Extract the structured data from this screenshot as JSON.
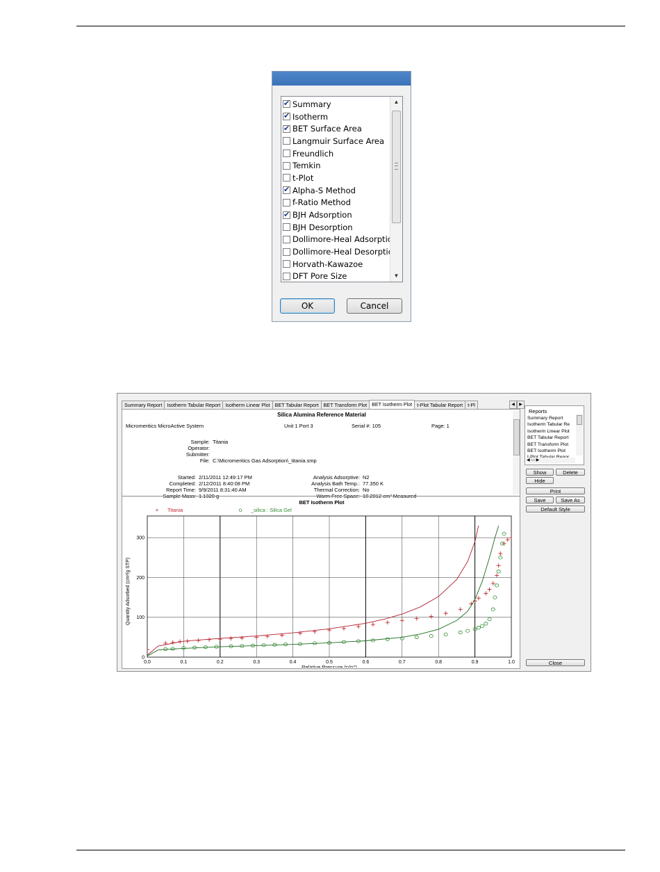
{
  "dialog": {
    "items": [
      {
        "label": "Summary",
        "checked": true
      },
      {
        "label": "Isotherm",
        "checked": true
      },
      {
        "label": "BET Surface Area",
        "checked": true
      },
      {
        "label": "Langmuir Surface Area",
        "checked": false
      },
      {
        "label": "Freundlich",
        "checked": false
      },
      {
        "label": "Temkin",
        "checked": false
      },
      {
        "label": "t-Plot",
        "checked": false
      },
      {
        "label": "Alpha-S Method",
        "checked": true
      },
      {
        "label": "f-Ratio Method",
        "checked": false
      },
      {
        "label": "BJH Adsorption",
        "checked": true
      },
      {
        "label": "BJH Desorption",
        "checked": false
      },
      {
        "label": "Dollimore-Heal Adsorption",
        "checked": false
      },
      {
        "label": "Dollimore-Heal Desorption",
        "checked": false
      },
      {
        "label": "Horvath-Kawazoe",
        "checked": false
      },
      {
        "label": "DFT Pore Size",
        "checked": false
      }
    ],
    "ok_label": "OK",
    "cancel_label": "Cancel"
  },
  "report_window": {
    "tabs": [
      "Summary Report",
      "Isotherm Tabular Report",
      "Isotherm Linear Plot",
      "BET Tabular Report",
      "BET Transform Plot",
      "BET Isotherm Plot",
      "t-Plot Tabular Report",
      "t-Pl"
    ],
    "active_tab": "BET Isotherm Plot",
    "header": {
      "title": "Silica Alumina Reference Material",
      "system": "Micromeritics MicroActive System",
      "unit": "Unit 1 Port 3",
      "serial": "Serial #: 105",
      "page": "Page: 1",
      "sample_label": "Sample:",
      "sample": "Titania",
      "operator_label": "Operator:",
      "submitter_label": "Submitter:",
      "file_label": "File:",
      "file": "C:\\Micromeritics Gas Adsorption\\_titania.smp",
      "started_label": "Started:",
      "started": "2/11/2011 12:49:17 PM",
      "completed_label": "Completed:",
      "completed": "2/12/2011 8:40:08 PM",
      "report_time_label": "Report Time:",
      "report_time": "9/9/2011 8:31:40 AM",
      "sample_mass_label": "Sample Mass:",
      "sample_mass": "1.1320 g",
      "adsorptive_label": "Analysis Adsorptive:",
      "adsorptive": "N2",
      "bath_label": "Analysis Bath Temp.:",
      "bath": "77.350 K",
      "thermal_label": "Thermal Correction:",
      "thermal": "No",
      "warm_label": "Warm Free Space:",
      "warm": "10.2012 cm³ Measured"
    },
    "sidebar": {
      "title": "Reports",
      "items": [
        "Summary Report",
        "Isotherm Tabular Re",
        "Isotherm Linear Plot",
        "BET Tabular Report",
        "BET Transform Plot",
        "BET Isotherm Plot",
        "t-Plot Tabular Repor"
      ],
      "show": "Show",
      "delete": "Delete",
      "hide": "Hide",
      "print": "Print",
      "save": "Save",
      "save_as": "Save As",
      "default_style": "Default Style",
      "close": "Close"
    }
  },
  "chart_data": {
    "type": "scatter",
    "title": "BET Isotherm Plot",
    "xlabel": "Relative Pressure (p/p°)",
    "ylabel": "Quantity Adsorbed (cm³/g STP)",
    "xlim": [
      0.0,
      1.0
    ],
    "ylim": [
      0,
      330
    ],
    "xticks": [
      "0.0",
      "0.1",
      "0.2",
      "0.3",
      "0.4",
      "0.5",
      "0.6",
      "0.7",
      "0.8",
      "0.9",
      "1.0"
    ],
    "yticks": [
      "0",
      "100",
      "200",
      "300"
    ],
    "grid": true,
    "legend_position": "top",
    "series": [
      {
        "name": "Titania",
        "marker": "+",
        "color": "#c0282d",
        "points": [
          [
            0.0,
            19
          ],
          [
            0.05,
            35
          ],
          [
            0.07,
            37
          ],
          [
            0.09,
            39
          ],
          [
            0.11,
            40
          ],
          [
            0.14,
            42
          ],
          [
            0.17,
            44
          ],
          [
            0.2,
            45
          ],
          [
            0.23,
            47
          ],
          [
            0.26,
            48
          ],
          [
            0.3,
            50
          ],
          [
            0.33,
            52
          ],
          [
            0.37,
            55
          ],
          [
            0.42,
            60
          ],
          [
            0.46,
            64
          ],
          [
            0.5,
            68
          ],
          [
            0.54,
            72
          ],
          [
            0.58,
            77
          ],
          [
            0.62,
            82
          ],
          [
            0.66,
            87
          ],
          [
            0.7,
            92
          ],
          [
            0.74,
            97
          ],
          [
            0.78,
            102
          ],
          [
            0.82,
            110
          ],
          [
            0.86,
            120
          ],
          [
            0.89,
            134
          ],
          [
            0.9,
            141
          ],
          [
            0.91,
            148
          ],
          [
            0.93,
            160
          ],
          [
            0.94,
            170
          ],
          [
            0.95,
            185
          ],
          [
            0.96,
            205
          ],
          [
            0.965,
            230
          ],
          [
            0.97,
            260
          ],
          [
            0.98,
            285
          ],
          [
            0.99,
            295
          ],
          [
            1.0,
            300
          ]
        ],
        "fit": [
          [
            0.0,
            5
          ],
          [
            0.03,
            28
          ],
          [
            0.1,
            40
          ],
          [
            0.2,
            47
          ],
          [
            0.3,
            53
          ],
          [
            0.4,
            61
          ],
          [
            0.5,
            71
          ],
          [
            0.6,
            85
          ],
          [
            0.65,
            95
          ],
          [
            0.7,
            108
          ],
          [
            0.75,
            126
          ],
          [
            0.8,
            152
          ],
          [
            0.85,
            195
          ],
          [
            0.88,
            240
          ],
          [
            0.9,
            290
          ],
          [
            0.91,
            330
          ]
        ]
      },
      {
        "name": "_silica : Silica Gel",
        "marker": "o",
        "color": "#2e8b2e",
        "points": [
          [
            0.05,
            20
          ],
          [
            0.07,
            21
          ],
          [
            0.1,
            23
          ],
          [
            0.13,
            24
          ],
          [
            0.16,
            25
          ],
          [
            0.19,
            26
          ],
          [
            0.23,
            27
          ],
          [
            0.26,
            28
          ],
          [
            0.29,
            29
          ],
          [
            0.32,
            30
          ],
          [
            0.35,
            31
          ],
          [
            0.38,
            32
          ],
          [
            0.42,
            33
          ],
          [
            0.46,
            35
          ],
          [
            0.5,
            36
          ],
          [
            0.54,
            38
          ],
          [
            0.58,
            40
          ],
          [
            0.62,
            42
          ],
          [
            0.66,
            45
          ],
          [
            0.7,
            47
          ],
          [
            0.74,
            50
          ],
          [
            0.78,
            53
          ],
          [
            0.82,
            57
          ],
          [
            0.86,
            62
          ],
          [
            0.88,
            66
          ],
          [
            0.9,
            70
          ],
          [
            0.91,
            74
          ],
          [
            0.92,
            78
          ],
          [
            0.93,
            84
          ],
          [
            0.94,
            95
          ],
          [
            0.95,
            120
          ],
          [
            0.955,
            150
          ],
          [
            0.96,
            180
          ],
          [
            0.965,
            215
          ],
          [
            0.97,
            250
          ],
          [
            0.975,
            285
          ],
          [
            0.98,
            310
          ]
        ],
        "fit": [
          [
            0.0,
            3
          ],
          [
            0.03,
            18
          ],
          [
            0.1,
            22
          ],
          [
            0.2,
            26
          ],
          [
            0.3,
            29
          ],
          [
            0.4,
            32
          ],
          [
            0.5,
            36
          ],
          [
            0.6,
            41
          ],
          [
            0.7,
            50
          ],
          [
            0.75,
            58
          ],
          [
            0.8,
            70
          ],
          [
            0.85,
            92
          ],
          [
            0.88,
            115
          ],
          [
            0.9,
            145
          ],
          [
            0.92,
            190
          ],
          [
            0.94,
            250
          ],
          [
            0.955,
            300
          ],
          [
            0.965,
            330
          ]
        ]
      }
    ]
  }
}
